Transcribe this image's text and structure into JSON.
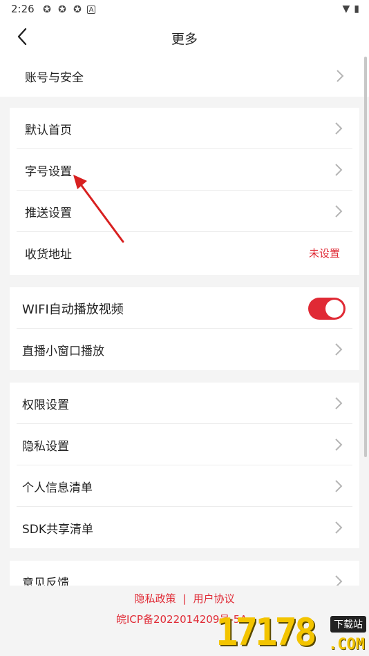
{
  "status": {
    "time": "2:26",
    "badge": "A"
  },
  "header": {
    "title": "更多"
  },
  "card1": {
    "items": [
      {
        "label": "账号与安全"
      }
    ]
  },
  "card2": {
    "items": [
      {
        "label": "默认首页"
      },
      {
        "label": "字号设置"
      },
      {
        "label": "推送设置"
      },
      {
        "label": "收货地址",
        "value": "未设置"
      }
    ]
  },
  "card3": {
    "items": [
      {
        "label": "WIFI自动播放视频",
        "toggle": true
      },
      {
        "label": "直播小窗口播放"
      }
    ]
  },
  "card4": {
    "items": [
      {
        "label": "权限设置"
      },
      {
        "label": "隐私设置"
      },
      {
        "label": "个人信息清单"
      },
      {
        "label": "SDK共享清单"
      }
    ]
  },
  "card5": {
    "items": [
      {
        "label": "意见反馈"
      }
    ]
  },
  "footer": {
    "privacy": "隐私政策",
    "separator": "|",
    "agreement": "用户协议",
    "icp": "皖ICP备2022014209号-5A"
  },
  "watermark": {
    "digits": "17178",
    "tag": "下载站",
    "suffix": ".COM"
  },
  "colors": {
    "accent": "#e02a35"
  }
}
